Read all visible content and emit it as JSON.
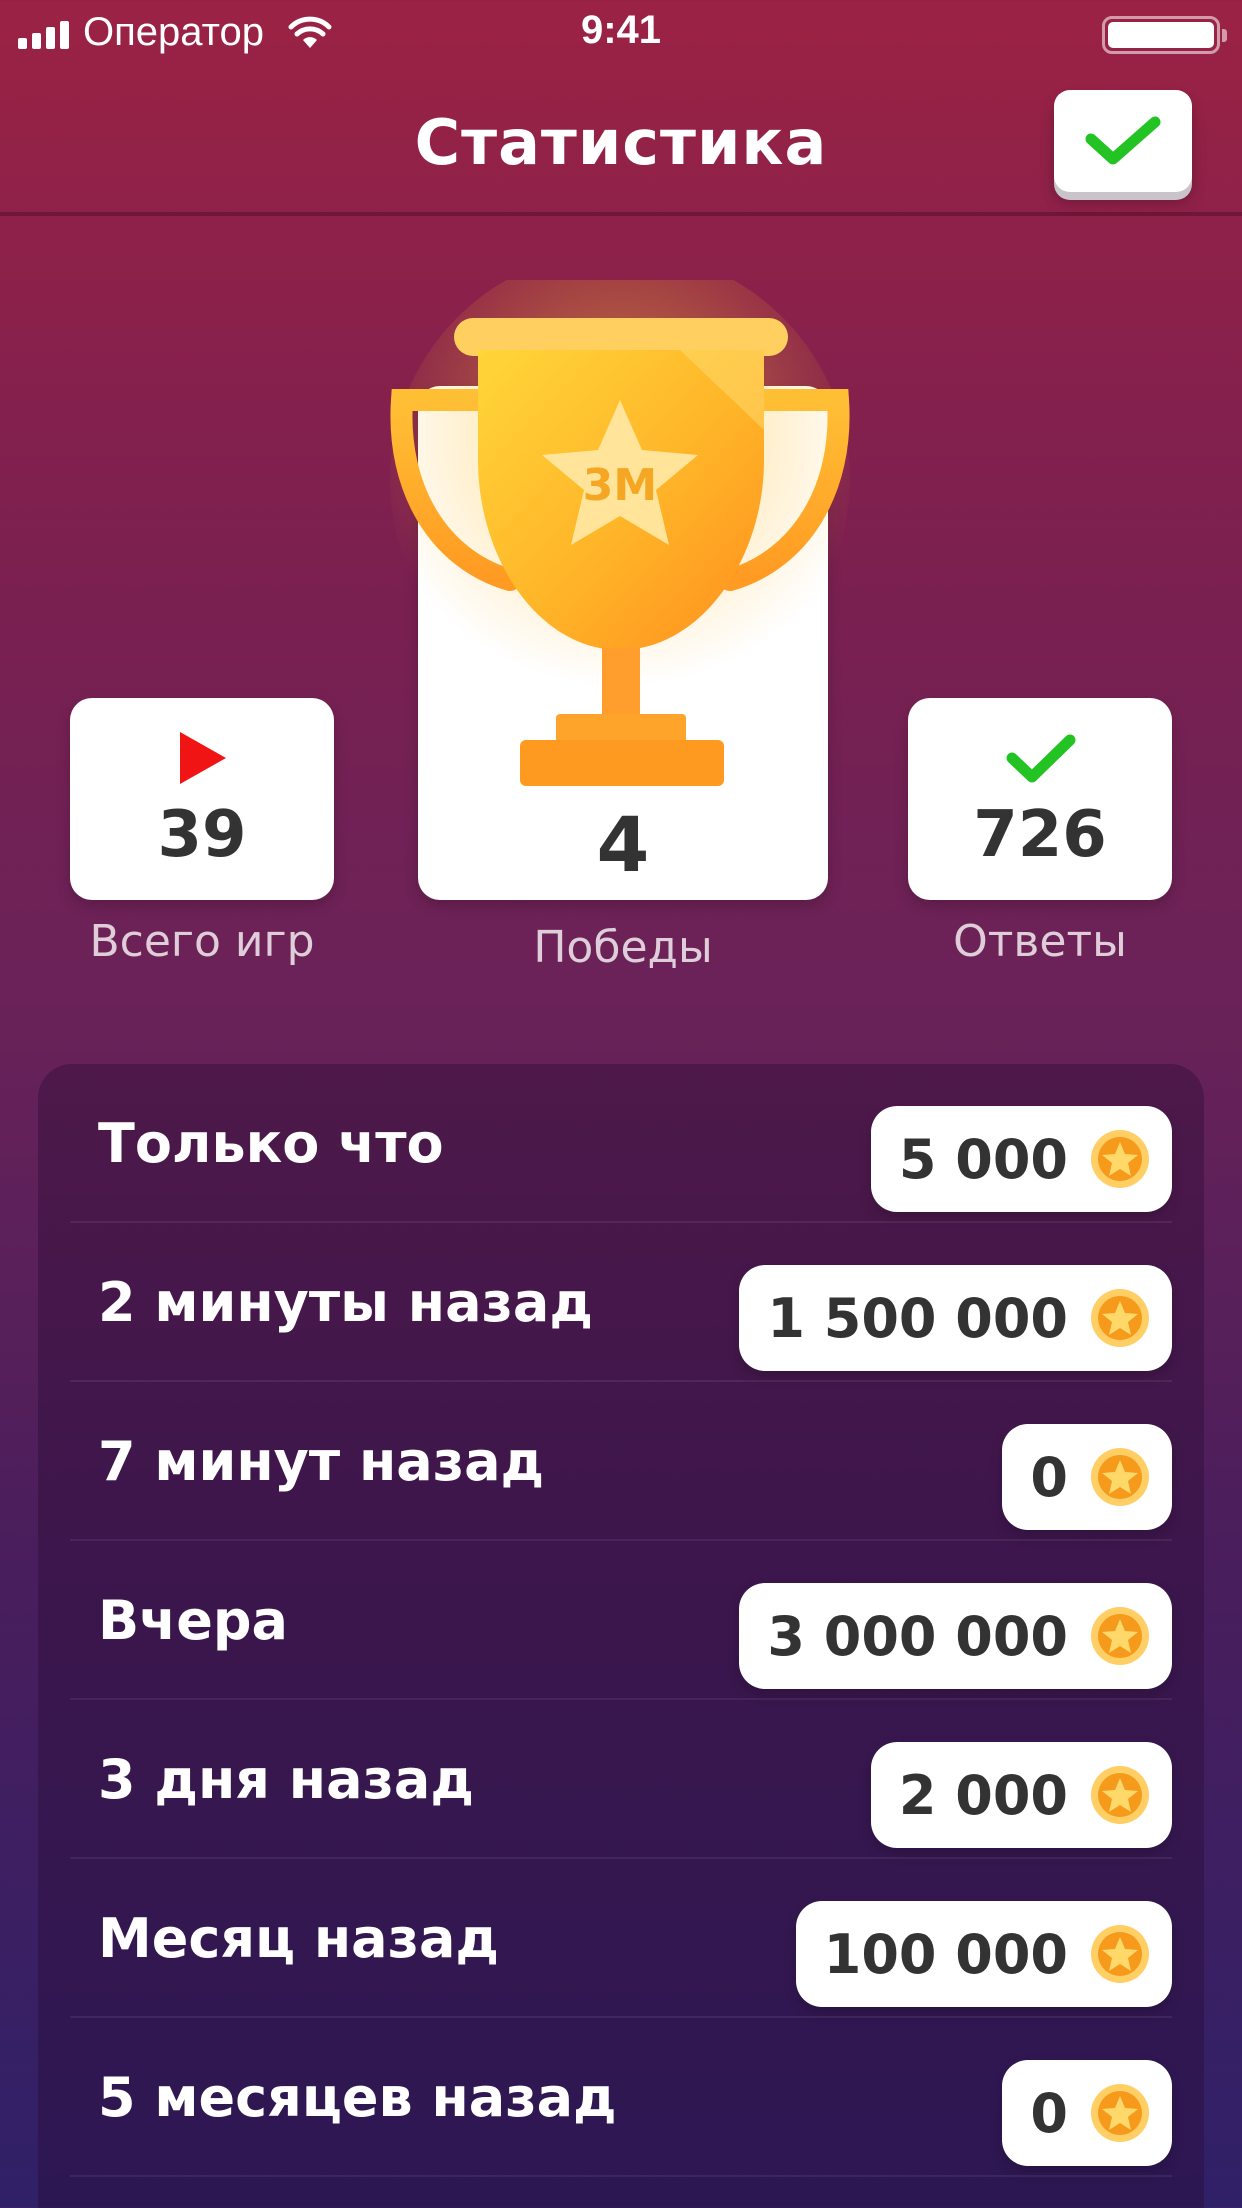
{
  "status_bar": {
    "carrier": "Оператор",
    "time": "9:41"
  },
  "header": {
    "title": "Статистика",
    "confirm_icon": "checkmark-icon"
  },
  "stats": {
    "total_games": {
      "value": "39",
      "label": "Всего игр",
      "icon": "play-icon",
      "icon_color": "#f01414"
    },
    "wins": {
      "value": "4",
      "label": "Победы",
      "icon": "trophy-icon",
      "trophy_text": "3M"
    },
    "answers": {
      "value": "726",
      "label": "Ответы",
      "icon": "checkmark-icon",
      "icon_color": "#22c322"
    }
  },
  "history": [
    {
      "time": "Только что",
      "amount": "5 000"
    },
    {
      "time": "2 минуты назад",
      "amount": "1 500 000"
    },
    {
      "time": "7 минут назад",
      "amount": "0"
    },
    {
      "time": "Вчера",
      "amount": "3 000 000"
    },
    {
      "time": "3 дня назад",
      "amount": "2 000"
    },
    {
      "time": "Месяц назад",
      "amount": "100 000"
    },
    {
      "time": "5 месяцев назад",
      "amount": "0"
    }
  ],
  "colors": {
    "accent_green": "#22c322",
    "play_red": "#f01414",
    "coin_orange": "#f59a1a",
    "background_top": "#9b2244",
    "background_bottom": "#302068"
  }
}
